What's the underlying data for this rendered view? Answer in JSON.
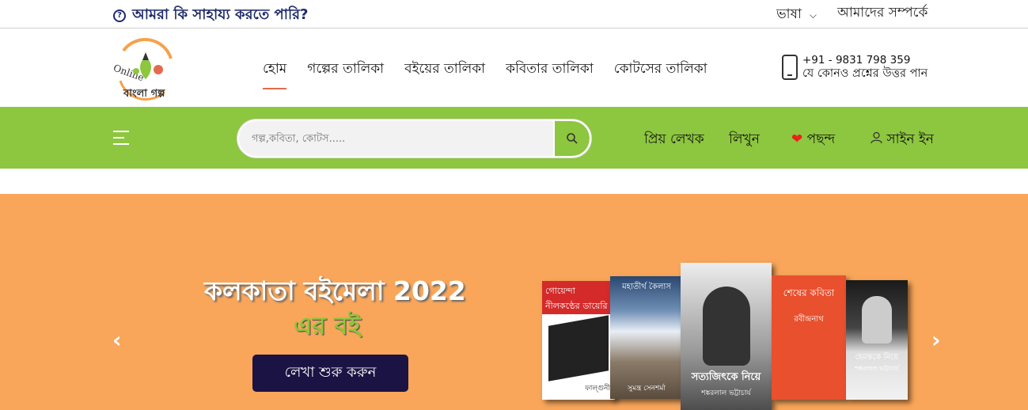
{
  "topbar": {
    "help_text": "আমরা কি সাহায্য করতে পারি?",
    "help_icon": "?",
    "language_label": "ভাষা",
    "about_label": "আমাদের সম্পর্কে"
  },
  "header": {
    "logo_alt": "Online বাংলা গল্প",
    "nav": [
      "হোম",
      "গল্পের তালিকা",
      "বইয়ের তালিকা",
      "কবিতার তালিকা",
      "কোটসের তালিকা"
    ],
    "phone": "+91 - 9831 798 359",
    "phone_caption": "যে কোনও প্রশ্নের উত্তর পান"
  },
  "toolbar": {
    "search_placeholder": "গল্প,কবিতা, কোটস.....",
    "fav_writers": "প্রিয় লেখক",
    "write": "লিখুন",
    "likes": "পছন্দ",
    "sign_in": "সাইন ইন"
  },
  "hero": {
    "title": "কলকাতা বইমেলা 2022",
    "subtitle": "এর বই",
    "cta": "লেখা শুরু করুন",
    "books": [
      {
        "name": "গোয়েন্দা নীলকণ্ঠের ডায়েরি",
        "author": "ফাল্গুনী"
      },
      {
        "name": "মহাতীর্থ কৈলাস",
        "author": "সুমন্ত্র সেনশর্মা"
      },
      {
        "name": "সত্যজিৎকে নিয়ে",
        "author": "শঙ্করলাল ভট্টাচার্য"
      },
      {
        "name": "শেষের কবিতা",
        "author": "রবীন্দ্রনাথ"
      },
      {
        "name": "হেমন্তকে নিয়ে",
        "author": "শঙ্করলাল ভট্টাচার্য"
      }
    ]
  },
  "colors": {
    "brand_green": "#8dc63f",
    "hero_orange": "#f9a65a",
    "cta_navy": "#1b1343",
    "accent_red": "#e46a4f"
  }
}
